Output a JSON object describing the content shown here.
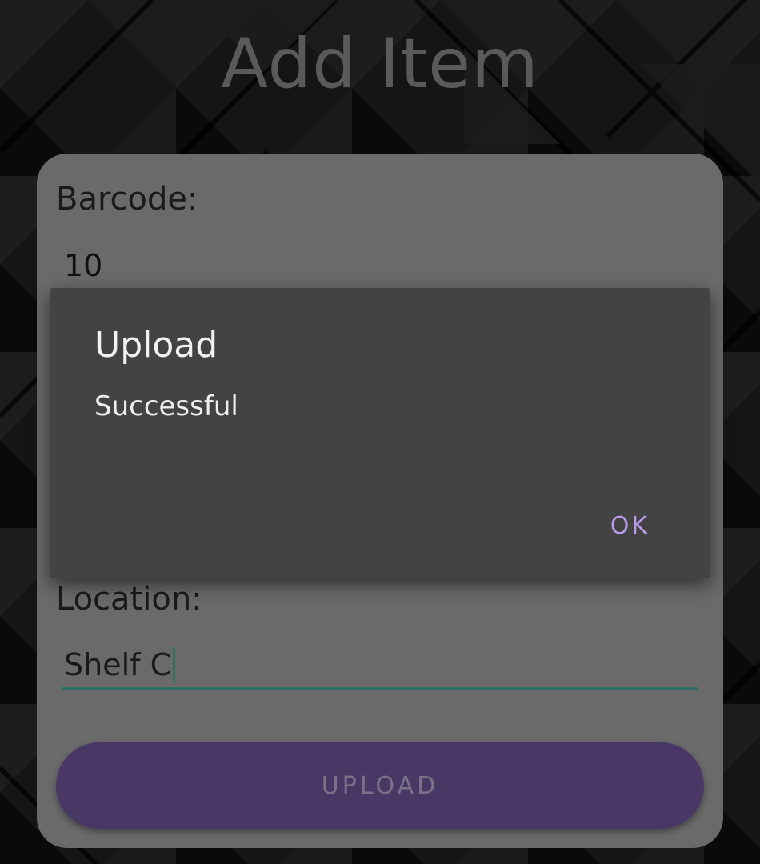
{
  "page": {
    "title": "Add Item"
  },
  "form": {
    "barcode_label": "Barcode:",
    "barcode_value": "10",
    "location_label": "Location:",
    "location_value": "Shelf C",
    "upload_label": "UPLOAD"
  },
  "dialog": {
    "title": "Upload",
    "message": "Successful",
    "ok_label": "OK"
  },
  "colors": {
    "card": "#6a6a6a",
    "dialog": "#434343",
    "accent": "#b99ae6",
    "button": "#493865",
    "input_underline": "#2f6f66"
  }
}
